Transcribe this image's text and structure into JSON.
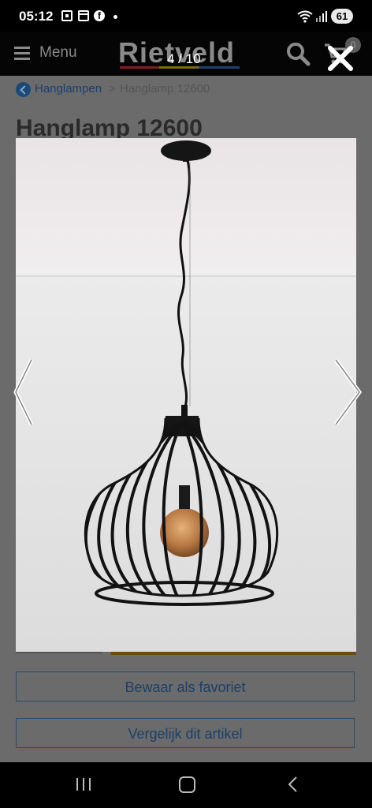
{
  "status_bar": {
    "time": "05:12",
    "battery": "61",
    "icons": [
      "screenshot-icon",
      "calendar-icon",
      "facebook-icon",
      "notification-dot",
      "wifi-icon",
      "signal-icon",
      "battery-icon"
    ]
  },
  "header": {
    "menu_label": "Menu",
    "logo_text": "Rietveld",
    "cart_count": "0"
  },
  "lightbox": {
    "counter": "4 / 10",
    "image_subject": "black wire cage pendant lamp with amber bulb"
  },
  "breadcrumb": {
    "parent": "Hanglampen",
    "separator": ">",
    "current": "Hanglamp 12600"
  },
  "product": {
    "title": "Hanglamp 12600"
  },
  "actions": {
    "favorite_label": "Bewaar als favoriet",
    "compare_label": "Vergelijk dit artikel"
  },
  "colors": {
    "link_blue": "#1b3f6a",
    "overlay": "#6b6b6b",
    "header_bg": "#050505"
  }
}
